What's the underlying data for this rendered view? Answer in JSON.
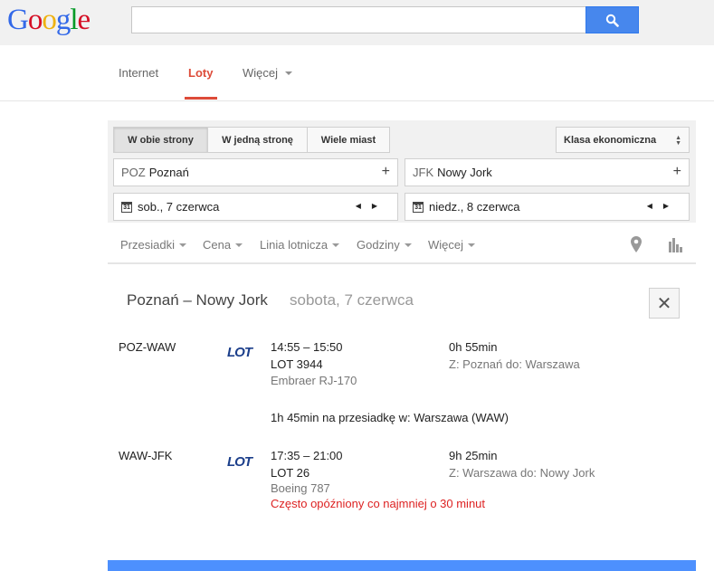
{
  "header": {
    "logo_letters": [
      "G",
      "o",
      "o",
      "g",
      "l",
      "e"
    ],
    "logo_colors": [
      "#3369e8",
      "#d50f25",
      "#eeb211",
      "#3369e8",
      "#009925",
      "#d50f25"
    ],
    "search_value": "",
    "search_icon": "search-icon"
  },
  "nav": {
    "internet": "Internet",
    "flights": "Loty",
    "more": "Więcej",
    "active_color": "#dd4b39"
  },
  "search_panel": {
    "trip_types": [
      "W obie strony",
      "W jedną stronę",
      "Wiele miast"
    ],
    "selected_trip": "W obie strony",
    "cabin_class": "Klasa ekonomiczna",
    "origin_code": "POZ",
    "origin_city": "Poznań",
    "destination_code": "JFK",
    "destination_city": "Nowy Jork",
    "calendar_icon_text": "31",
    "depart_date": "sob., 7 czerwca",
    "return_date": "niedz., 8 czerwca"
  },
  "filters": {
    "items": [
      "Przesiadki",
      "Cena",
      "Linia lotnicza",
      "Godziny",
      "Więcej"
    ],
    "icons": [
      "map-pin-icon",
      "bar-chart-icon"
    ]
  },
  "result": {
    "route": "Poznań – Nowy Jork",
    "date": "sobota, 7 czerwca",
    "close_symbol": "✕",
    "segments": [
      {
        "route": "POZ-WAW",
        "airline_logo": "LOT",
        "times": "14:55 – 15:50",
        "flight": "LOT 3944",
        "aircraft": "Embraer RJ-170",
        "duration": "0h 55min",
        "from_to": "Z: Poznań do: Warszawa",
        "warning": ""
      },
      {
        "route": "WAW-JFK",
        "airline_logo": "LOT",
        "times": "17:35 – 21:00",
        "flight": "LOT 26",
        "aircraft": "Boeing 787",
        "duration": "9h 25min",
        "from_to": "Z: Warszawa do: Nowy Jork",
        "warning": "Często opóźniony co najmniej o 30 minut"
      }
    ],
    "layover": "1h 45min na przesiadkę w: Warszawa (WAW)"
  }
}
